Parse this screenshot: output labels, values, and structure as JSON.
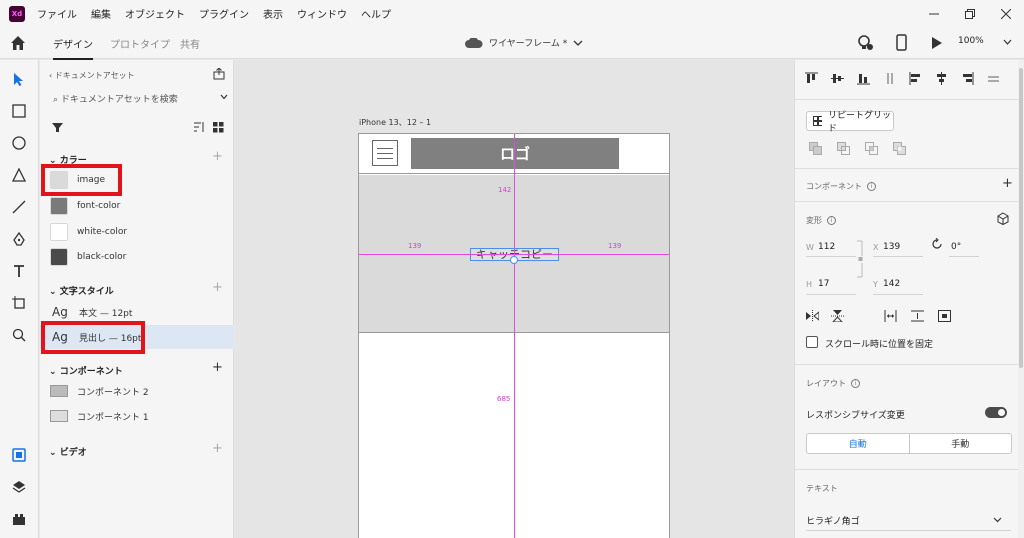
{
  "app": {
    "logo_text": "Xd"
  },
  "menubar": {
    "items": [
      "ファイル",
      "編集",
      "オブジェクト",
      "プラグイン",
      "表示",
      "ウィンドウ",
      "ヘルプ"
    ]
  },
  "toolbar": {
    "tabs": [
      "デザイン",
      "プロトタイプ",
      "共有"
    ],
    "doc_title": "ワイヤーフレーム *",
    "zoom": "100%"
  },
  "assets": {
    "header": "ドキュメントアセット",
    "search_placeholder": "ドキュメントアセットを検索",
    "colors_title": "カラー",
    "colors": [
      {
        "name": "image",
        "hex": "#dadada"
      },
      {
        "name": "font-color",
        "hex": "#7a7a7a"
      },
      {
        "name": "white-color",
        "hex": "#ffffff"
      },
      {
        "name": "black-color",
        "hex": "#4a4a4a"
      }
    ],
    "text_styles_title": "文字スタイル",
    "text_styles": [
      {
        "glyph": "Ag",
        "label": "本文 — 12pt"
      },
      {
        "glyph": "Ag",
        "label": "見出し — 16pt"
      }
    ],
    "components_title": "コンポーネント",
    "components": [
      "コンポーネント 2",
      "コンポーネント 1"
    ],
    "video_title": "ビデオ"
  },
  "canvas": {
    "artboard_name": "iPhone 13、12 – 1",
    "logo_text": "ロゴ",
    "catch_copy": "キャッチコピー",
    "guides": {
      "top": "142",
      "left": "139",
      "right": "139",
      "bottom": "685"
    }
  },
  "props": {
    "repeat_grid": "リピートグリッド",
    "component_label": "コンポーネント",
    "transform_label": "変形",
    "w_label": "W",
    "w_value": "112",
    "h_label": "H",
    "h_value": "17",
    "x_label": "X",
    "x_value": "139",
    "y_label": "Y",
    "y_value": "142",
    "rotation": "0°",
    "fix_scroll_label": "スクロール時に位置を固定",
    "layout_label": "レイアウト",
    "responsive_label": "レスポンシブサイズ変更",
    "auto_label": "自動",
    "manual_label": "手動",
    "text_label": "テキスト",
    "font_name": "ヒラギノ角ゴ"
  },
  "colors": {
    "accent": "#1473e6",
    "highlight": "#e0141a",
    "guide": "#e14ce0"
  }
}
